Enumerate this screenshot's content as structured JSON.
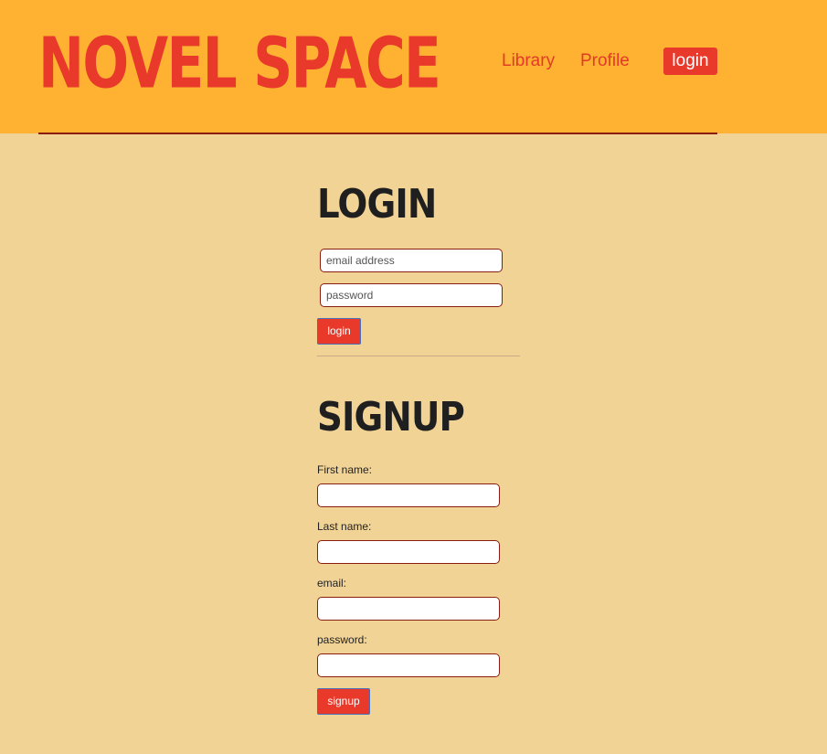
{
  "header": {
    "brand": "NOVEL SPACE",
    "nav": {
      "library": "Library",
      "profile": "Profile",
      "login": "login"
    }
  },
  "login": {
    "title": "LOGIN",
    "email_placeholder": "email address",
    "password_placeholder": "password",
    "button": "login"
  },
  "signup": {
    "title": "SIGNUP",
    "first_name_label": "First name:",
    "last_name_label": "Last name:",
    "email_label": "email:",
    "password_label": "password:",
    "button": "signup"
  },
  "colors": {
    "page_background": "#f2d396",
    "header_background": "#ffb232",
    "accent": "#e8392a",
    "heading_text": "#1f1f1f",
    "input_border": "#8a1d12"
  }
}
